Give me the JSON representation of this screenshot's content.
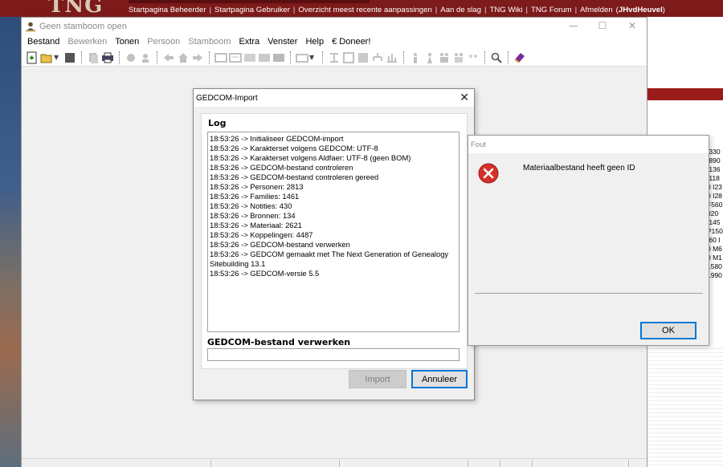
{
  "web": {
    "logo": "TNG",
    "nav_items": [
      "Startpagina Beheerder",
      "Startpagina Gebruiker",
      "Overzicht meest recente aanpassingen",
      "Aan de slag",
      "TNG Wiki",
      "TNG Forum",
      "Afmelden"
    ],
    "user": "JHvdHeuvel",
    "side_codes": [
      "I330",
      "I890",
      "I136",
      "I118",
      "0 I23",
      "0 I28",
      "F560",
      "020",
      "I145",
      "P150",
      "I60 I",
      "0 M6",
      "0 M1",
      "1580",
      "1990"
    ]
  },
  "app": {
    "title": "Geen stamboom open",
    "window_controls": {
      "minimize": "—",
      "maximize": "☐",
      "close": "✕"
    },
    "menu": [
      {
        "label": "Bestand",
        "enabled": true
      },
      {
        "label": "Bewerken",
        "enabled": false
      },
      {
        "label": "Tonen",
        "enabled": true
      },
      {
        "label": "Persoon",
        "enabled": false
      },
      {
        "label": "Stamboom",
        "enabled": false
      },
      {
        "label": "Extra",
        "enabled": true
      },
      {
        "label": "Venster",
        "enabled": true
      },
      {
        "label": "Help",
        "enabled": true
      },
      {
        "label": "€ Doneer!",
        "enabled": true
      }
    ]
  },
  "gedcom_dialog": {
    "title": "GEDCOM-Import",
    "close": "✕",
    "log_label": "Log",
    "log_lines": [
      "18:53:26 -> Initialiseer GEDCOM-import",
      "18:53:26 -> Karakterset volgens GEDCOM: UTF-8",
      "18:53:26 -> Karakterset volgens Aldfaer: UTF-8 (geen BOM)",
      "18:53:26 -> GEDCOM-bestand controleren",
      "18:53:26 -> GEDCOM-bestand controleren gereed",
      "18:53:26 -> Personen: 2813",
      "18:53:26 -> Families: 1461",
      "18:53:26 -> Notities: 430",
      "18:53:26 -> Bronnen: 134",
      "18:53:26 -> Materiaal: 2621",
      "18:53:26 -> Koppelingen: 4487",
      "18:53:26 -> GEDCOM-bestand verwerken",
      "18:53:26 -> GEDCOM gemaakt met The Next Generation of Genealogy Sitebuilding 13.1",
      "18:53:26 -> GEDCOM-versie 5.5"
    ],
    "process_label": "GEDCOM-bestand verwerken",
    "import_button": "Import",
    "cancel_button": "Annuleer"
  },
  "error_dialog": {
    "title": "Fout",
    "message": "Materiaalbestand heeft geen ID",
    "ok_button": "OK"
  }
}
